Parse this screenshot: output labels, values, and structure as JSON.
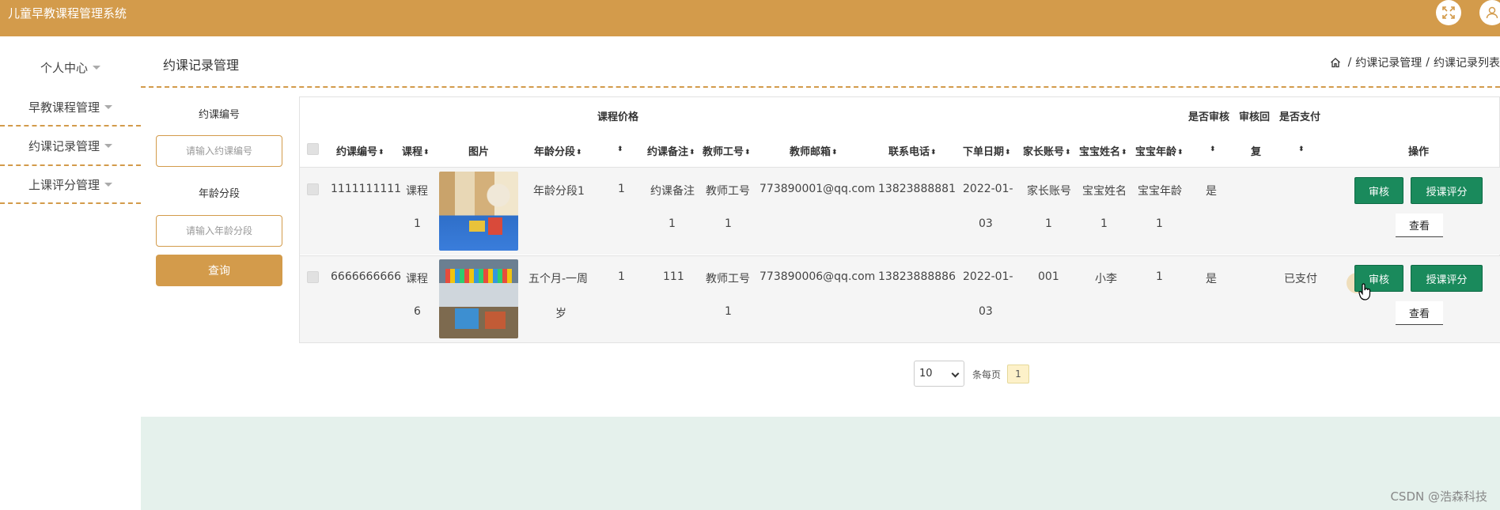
{
  "app": {
    "title": "儿童早教课程管理系统",
    "accent": "#d39b4b"
  },
  "topbar": {
    "fullscreen_icon": "expand-icon",
    "user_icon": "user-icon"
  },
  "sidebar": {
    "items": [
      {
        "label": "个人中心"
      },
      {
        "label": "早教课程管理"
      },
      {
        "label": "约课记录管理"
      },
      {
        "label": "上课评分管理"
      }
    ]
  },
  "page": {
    "title": "约课记录管理"
  },
  "breadcrumb": {
    "items": [
      "约课记录管理",
      "约课记录列表"
    ]
  },
  "search": {
    "field1_label": "约课编号",
    "field1_placeholder": "请输入约课编号",
    "field2_label": "年龄分段",
    "field2_placeholder": "请输入年龄分段",
    "button": "查询"
  },
  "table": {
    "group_headers": {
      "price": "课程价格",
      "audit": "是否审核",
      "audit_reply": "审核回",
      "paid": "是否支付"
    },
    "columns": [
      "约课编号",
      "课程",
      "图片",
      "年龄分段",
      "约课备注",
      "教师工号",
      "教师邮箱",
      "联系电话",
      "下单日期",
      "家长账号",
      "宝宝姓名",
      "宝宝年龄",
      "复",
      "操作"
    ],
    "rows": [
      {
        "id": "1111111111",
        "course_a": "课程",
        "course_b": "1",
        "age_a": "年龄分段1",
        "age_b": "",
        "price": "1",
        "note_a": "约课备注",
        "note_b": "1",
        "teacher_a": "教师工号",
        "teacher_b": "1",
        "email": "773890001@qq.com",
        "phone": "13823888881",
        "date_a": "2022-01-",
        "date_b": "03",
        "parent_a": "家长账号",
        "parent_b": "1",
        "baby_a": "宝宝姓名",
        "baby_b": "1",
        "baby_age_a": "宝宝年龄",
        "baby_age_b": "1",
        "audit": "是",
        "reply": "",
        "paid": ""
      },
      {
        "id": "6666666666",
        "course_a": "课程",
        "course_b": "6",
        "age_a": "五个月-一周",
        "age_b": "岁",
        "price": "1",
        "note_a": "111",
        "note_b": "",
        "teacher_a": "教师工号",
        "teacher_b": "1",
        "email": "773890006@qq.com",
        "phone": "13823888886",
        "date_a": "2022-01-",
        "date_b": "03",
        "parent_a": "001",
        "parent_b": "",
        "baby_a": "小李",
        "baby_b": "",
        "baby_age_a": "1",
        "baby_age_b": "",
        "audit": "是",
        "reply": "",
        "paid": "已支付"
      }
    ],
    "actions": {
      "audit": "审核",
      "rate": "授课评分",
      "view": "查看"
    }
  },
  "pagination": {
    "page_size": "10",
    "per_page_label": "条每页",
    "current_page": "1"
  },
  "watermark": "CSDN @浩森科技"
}
